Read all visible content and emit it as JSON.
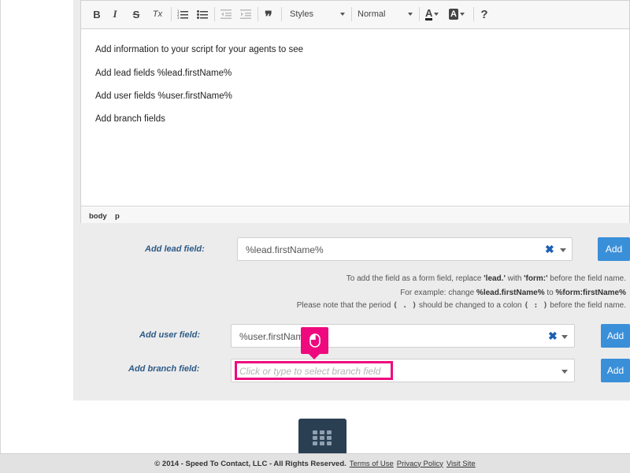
{
  "toolbar": {
    "bold": "B",
    "italic": "I",
    "strike": "S",
    "clear_format": "Tx",
    "blockquote": "❞",
    "styles": "Styles",
    "format": "Normal",
    "text_color": "A",
    "bg_color": "A",
    "help": "?"
  },
  "editor": {
    "paragraphs": [
      "Add information to your script for your agents to see",
      "Add lead fields %lead.firstName%",
      "Add user fields %user.firstName%",
      "Add branch fields"
    ],
    "path": [
      "body",
      "p"
    ]
  },
  "lead_field": {
    "label": "Add lead field:",
    "value": "%lead.firstName%",
    "clear": "✖",
    "button": "Add"
  },
  "notes": {
    "line1_pre": "To add the field as a form field, replace ",
    "line1_lead": "'lead.'",
    "line1_mid": " with ",
    "line1_form": "'form:'",
    "line1_post": " before the field name.",
    "line2_pre": "For example: change ",
    "line2_from": "%lead.firstName%",
    "line2_mid": " to ",
    "line2_to": "%form:firstName%",
    "line3_pre": "Please note that the period ",
    "line3_period": "( . )",
    "line3_mid": " should be changed to a colon ",
    "line3_colon": "( : )",
    "line3_post": " before the field name."
  },
  "user_field": {
    "label": "Add user field:",
    "value": "%user.firstName%",
    "clear": "✖",
    "button": "Add"
  },
  "branch_field": {
    "label": "Add branch field:",
    "placeholder": "Click or type to select branch field",
    "button": "Add"
  },
  "footer": {
    "copyright": "© 2014 - Speed To Contact, LLC - All Rights Reserved.",
    "terms": "Terms of Use",
    "privacy": "Privacy Policy",
    "visit": "Visit Site"
  },
  "colors": {
    "accent": "#3a8fd9",
    "label": "#2d5a87",
    "highlight": "#ee0a7e",
    "grid_button": "#2b3f52"
  }
}
